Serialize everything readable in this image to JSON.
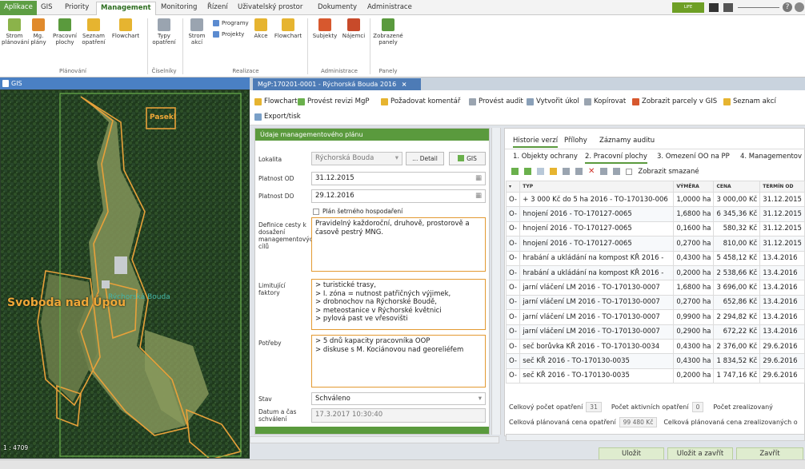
{
  "menu": {
    "tabs": [
      "Aplikace",
      "GIS",
      "Priority",
      "Management",
      "Monitoring",
      "Řízení",
      "Uživatelský prostor",
      "Dokumenty",
      "Administrace"
    ],
    "active": "Management",
    "brand": "LIFE CORCONTICA"
  },
  "ribbon": {
    "buttons": [
      {
        "label": "Strom plánování",
        "icon": "tree-plan-icon",
        "color": "#8bb34a"
      },
      {
        "label": "Mg. plány",
        "icon": "plans-icon",
        "color": "#e08a2c"
      },
      {
        "label": "Pracovní plochy",
        "icon": "workarea-icon",
        "color": "#5a9a3d"
      },
      {
        "label": "Seznam opatření",
        "icon": "measures-icon",
        "color": "#e6b430"
      },
      {
        "label": "Flowchart",
        "icon": "flowchart-icon",
        "color": "#e6b430"
      },
      {
        "label": "Typy opatření",
        "icon": "types-icon",
        "color": "#9aa4b0"
      },
      {
        "label": "Strom akcí",
        "icon": "tree-action-icon",
        "color": "#9aa4b0"
      },
      {
        "label": "Akce",
        "icon": "action-icon",
        "color": "#e6b430"
      },
      {
        "label": "Flowchart",
        "icon": "flowchart-icon",
        "color": "#e6b430"
      },
      {
        "label": "Subjekty",
        "icon": "subjects-icon",
        "color": "#d7582e"
      },
      {
        "label": "Nájemci",
        "icon": "tenants-icon",
        "color": "#c84a2a"
      },
      {
        "label": "Zobrazené panely",
        "icon": "panels-icon",
        "color": "#5a9a3d"
      }
    ],
    "small": [
      "Programy",
      "Projekty"
    ],
    "groups": [
      "Plánování",
      "Číselníky",
      "Realizace",
      "Administrace",
      "Panely"
    ]
  },
  "gis": {
    "title": "GIS",
    "labels": [
      "Pasekl",
      "Rýchorská Bouda",
      "Svoboda nad Úpou"
    ],
    "scale": "1 : 4709"
  },
  "doc_tab": "MgP:170201-0001 - Rýchorská Bouda 2016",
  "toolbar": [
    "Flowchart",
    "Provést revizi MgP",
    "Požadovat komentář",
    "Provést audit",
    "Vytvořit úkol",
    "Kopírovat",
    "Zobrazit parcely v GIS",
    "Seznam akcí",
    "Export/tisk"
  ],
  "form": {
    "title": "Údaje managementového plánu",
    "lokalita_label": "Lokalita",
    "lokalita": "Rýchorská Bouda",
    "detail_btn": "... Detail",
    "gis_btn": "GIS",
    "platnost_od_label": "Platnost OD",
    "platnost_od": "31.12.2015",
    "platnost_do_label": "Platnost DO",
    "platnost_do": "29.12.2016",
    "plan_label": "Plán šetrného hospodaření",
    "definice_label": "Definice cesty k dosažení managementových cílů",
    "definice": "Pravidelný každoroční, druhově, prostorově a časově pestrý MNG.",
    "limit_label": "Limitující faktory",
    "limit": [
      "> turistické trasy,",
      "> I. zóna = nutnost patřičných výjimek,",
      "> drobnochov na Rýchorské Boudě,",
      "> meteostanice v Rýchorské květnici",
      "> pylová past ve vřesovišti"
    ],
    "potreby_label": "Potřeby",
    "potreby": [
      "> 5 dnů kapacity pracovníka OOP",
      "> diskuse s M. Kociánovou nad georeliéfem"
    ],
    "stav_label": "Stav",
    "stav": "Schváleno",
    "datum_label": "Datum a čas schválení",
    "datum": "17.3.2017 10:30:40"
  },
  "right": {
    "tabs_top": [
      "Historie verzí",
      "Přílohy",
      "Záznamy auditu"
    ],
    "tabs": [
      "1. Objekty ochrany",
      "2. Pracovní plochy",
      "3. Omezení OO na PP",
      "4. Managementov"
    ],
    "show_deleted": "Zobrazit smazané",
    "columns": [
      "TYP",
      "VÝMĚRA",
      "CENA",
      "TERMÍN OD"
    ],
    "rows": [
      [
        "O-",
        "+ 3 000 Kč do 5 ha 2016 - TO-170130-006",
        "1,0000 ha",
        "3 000,00 Kč",
        "31.12.2015"
      ],
      [
        "O-",
        "hnojení 2016 - TO-170127-0065",
        "1,6800 ha",
        "6 345,36 Kč",
        "31.12.2015"
      ],
      [
        "O-",
        "hnojení 2016 - TO-170127-0065",
        "0,1600 ha",
        "580,32 Kč",
        "31.12.2015"
      ],
      [
        "O-",
        "hnojení 2016 - TO-170127-0065",
        "0,2700 ha",
        "810,00 Kč",
        "31.12.2015"
      ],
      [
        "O-",
        "hrabání a ukládání na kompost KŘ 2016 -",
        "0,4300 ha",
        "5 458,12 Kč",
        "13.4.2016"
      ],
      [
        "O-",
        "hrabání a ukládání na kompost KŘ 2016 -",
        "0,2000 ha",
        "2 538,66 Kč",
        "13.4.2016"
      ],
      [
        "O-",
        "jarní vláčení LM 2016 - TO-170130-0007",
        "1,6800 ha",
        "3 696,00 Kč",
        "13.4.2016"
      ],
      [
        "O-",
        "jarní vláčení LM 2016 - TO-170130-0007",
        "0,2700 ha",
        "652,86 Kč",
        "13.4.2016"
      ],
      [
        "O-",
        "jarní vláčení LM 2016 - TO-170130-0007",
        "0,9900 ha",
        "2 294,82 Kč",
        "13.4.2016"
      ],
      [
        "O-",
        "jarní vláčení LM 2016 - TO-170130-0007",
        "0,2900 ha",
        "672,22 Kč",
        "13.4.2016"
      ],
      [
        "O-",
        "seč borůvka KŘ 2016 - TO-170130-0034",
        "0,4300 ha",
        "2 376,00 Kč",
        "29.6.2016"
      ],
      [
        "O-",
        "seč KŘ 2016 - TO-170130-0035",
        "0,4300 ha",
        "1 834,52 Kč",
        "29.6.2016"
      ],
      [
        "O-",
        "seč KŘ 2016 - TO-170130-0035",
        "0,2000 ha",
        "1 747,16 Kč",
        "29.6.2016"
      ]
    ],
    "sum1_label": "Celkový počet opatření",
    "sum1": "31",
    "sum2_label": "Počet aktivních opatření",
    "sum2": "0",
    "sum3_label": "Počet zrealizovaný",
    "sum4_label": "Celková plánovaná cena opatření",
    "sum4": "99 480 Kč",
    "sum5_label": "Celková plánovaná cena zrealizovaných o"
  },
  "footer": {
    "save": "Uložit",
    "save_close": "Uložit a zavřít",
    "close": "Zavřít"
  }
}
